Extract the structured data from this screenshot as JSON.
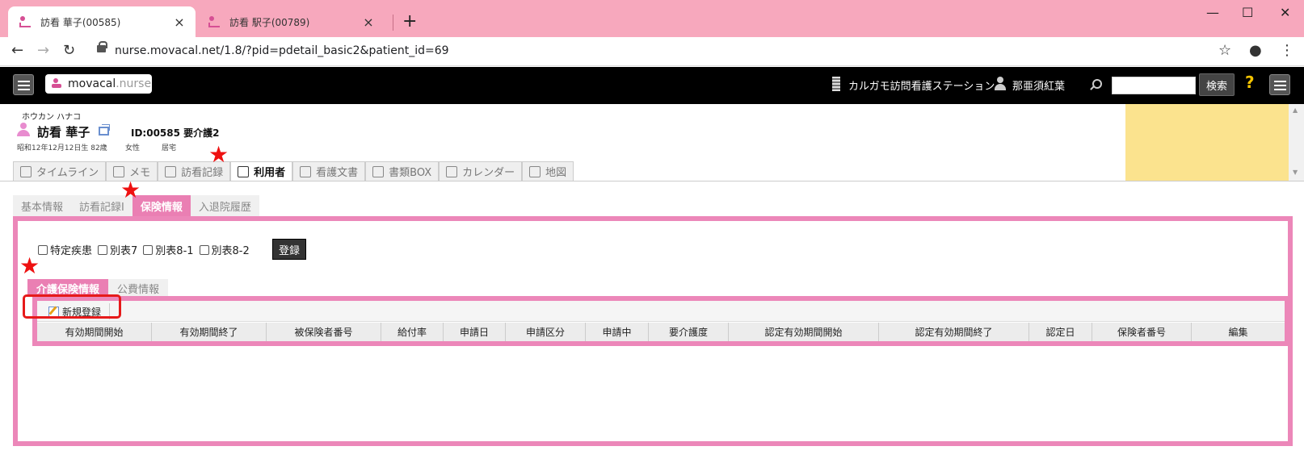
{
  "browser": {
    "tabs": [
      {
        "title": "訪看 華子(00585)",
        "active": true
      },
      {
        "title": "訪看 駅子(00789)",
        "active": false
      }
    ],
    "url": "nurse.movacal.net/1.8/?pid=pdetail_basic2&patient_id=69",
    "tab_color": "#f7a8bd"
  },
  "header": {
    "logo_main": "movacal",
    "logo_suffix": ".nurse",
    "station": "カルガモ訪問看護ステーション",
    "user": "那亜須紅葉",
    "search_button": "検索",
    "help": "?"
  },
  "patient": {
    "kana": "ホウカン ハナコ",
    "name": "訪看 華子",
    "id_line": "ID:00585 要介護2",
    "birth": "昭和12年12月12日生 82歳",
    "gender": "女性",
    "residence": "居宅"
  },
  "main_tabs": [
    {
      "label": "タイムライン",
      "active": false
    },
    {
      "label": "メモ",
      "active": false
    },
    {
      "label": "訪看記録",
      "active": false
    },
    {
      "label": "利用者",
      "active": true
    },
    {
      "label": "看護文書",
      "active": false
    },
    {
      "label": "書類BOX",
      "active": false
    },
    {
      "label": "カレンダー",
      "active": false
    },
    {
      "label": "地図",
      "active": false
    }
  ],
  "sub_tabs": [
    {
      "label": "基本情報",
      "active": false
    },
    {
      "label": "訪看記録I",
      "active": false
    },
    {
      "label": "保険情報",
      "active": true
    },
    {
      "label": "入退院履歴",
      "active": false
    }
  ],
  "checkboxes": [
    {
      "label": "特定疾患",
      "checked": false
    },
    {
      "label": "別表7",
      "checked": false
    },
    {
      "label": "別表8-1",
      "checked": false
    },
    {
      "label": "別表8-2",
      "checked": false
    }
  ],
  "register_button": "登録",
  "inner_tabs": [
    {
      "label": "介護保険情報",
      "active": true
    },
    {
      "label": "公費情報",
      "active": false
    }
  ],
  "new_button": "新規登録",
  "table": {
    "columns": [
      "有効期間開始",
      "有効期間終了",
      "被保険者番号",
      "給付率",
      "申請日",
      "申請区分",
      "申請中",
      "要介護度",
      "認定有効期間開始",
      "認定有効期間終了",
      "認定日",
      "保険者番号",
      "編集"
    ]
  },
  "colors": {
    "accent_pink": "#ec87b9",
    "annotation_red": "#e61a1a"
  }
}
